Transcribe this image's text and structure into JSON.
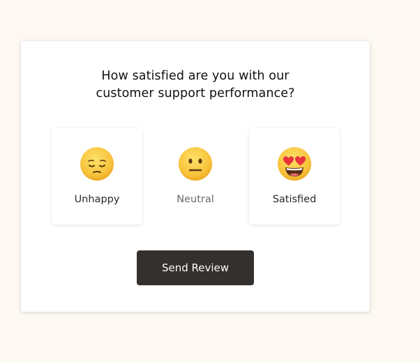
{
  "question": {
    "line1": "How satisfied are you with our",
    "line2": "customer support performance?"
  },
  "options": [
    {
      "label": "Unhappy",
      "icon": "pensive-face-icon"
    },
    {
      "label": "Neutral",
      "icon": "neutral-face-icon"
    },
    {
      "label": "Satisfied",
      "icon": "heart-eyes-face-icon"
    }
  ],
  "button": {
    "label": "Send Review"
  },
  "colors": {
    "page_background": "#fdf8f2",
    "card_background": "#ffffff",
    "button_background": "#33302e",
    "emoji_yellow": "#f8c23a",
    "heart_red": "#e8333c"
  }
}
